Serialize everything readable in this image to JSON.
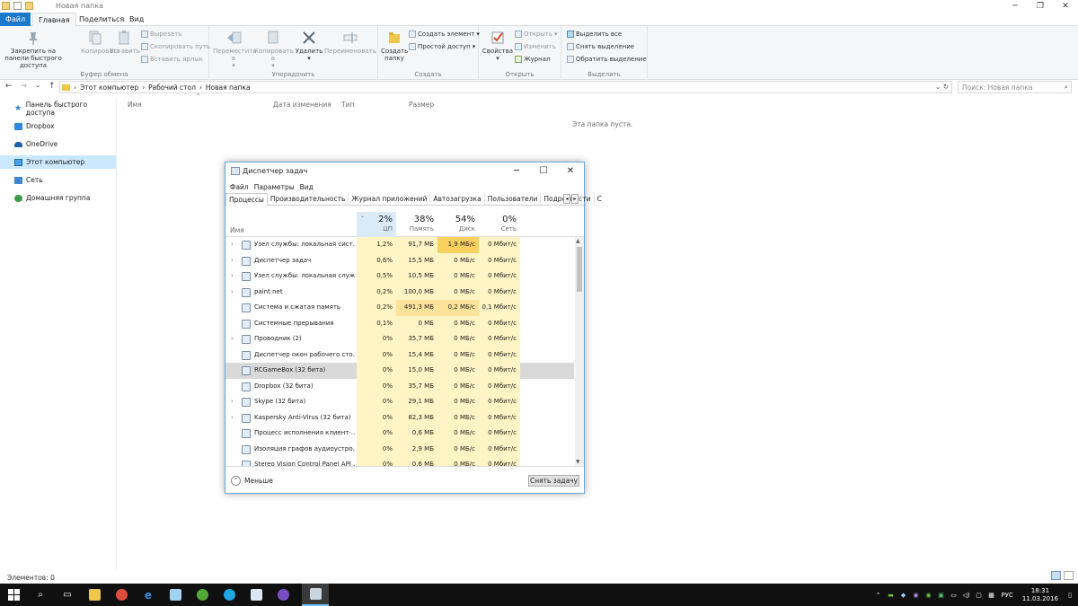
{
  "explorer": {
    "window_title": "Новая папка",
    "tabs": {
      "file": "Файл",
      "home": "Главная",
      "share": "Поделиться",
      "view": "Вид"
    },
    "ribbon": {
      "clipboard": {
        "label": "Буфер обмена",
        "pin": "Закрепить на панели быстрого доступа",
        "copy": "Копировать",
        "paste": "Вставить",
        "cut": "Вырезать",
        "copy_path": "Скопировать путь",
        "paste_shortcut": "Вставить ярлык"
      },
      "organize": {
        "label": "Упорядочить",
        "move_to": "Переместить в",
        "copy_to": "Копировать в",
        "delete": "Удалить",
        "rename": "Переименовать"
      },
      "create": {
        "label": "Создать",
        "new_folder": "Создать папку",
        "new_item": "Создать элемент",
        "easy_access": "Простой доступ"
      },
      "open": {
        "label": "Открыть",
        "properties": "Свойства",
        "open": "Открыть",
        "edit": "Изменить",
        "history": "Журнал"
      },
      "select": {
        "label": "Выделить",
        "select_all": "Выделить все",
        "select_none": "Снять выделение",
        "invert": "Обратить выделение"
      }
    },
    "address": {
      "path": [
        "Этот компьютер",
        "Рабочий стол",
        "Новая папка"
      ],
      "search_placeholder": "Поиск: Новая папка"
    },
    "nav_pane": {
      "items": [
        {
          "label": "Панель быстрого доступа",
          "icon": "star-icon"
        },
        {
          "label": "Dropbox",
          "icon": "dropbox-icon"
        },
        {
          "label": "OneDrive",
          "icon": "cloud-icon"
        },
        {
          "label": "Этот компьютер",
          "icon": "computer-icon"
        },
        {
          "label": "Сеть",
          "icon": "network-icon"
        },
        {
          "label": "Домашняя группа",
          "icon": "homegroup-icon"
        }
      ]
    },
    "columns": {
      "name": "Имя",
      "date": "Дата изменения",
      "type": "Тип",
      "size": "Размер"
    },
    "empty_message": "Эта папка пуста.",
    "status": "Элементов: 0"
  },
  "task_manager": {
    "title": "Диспетчер задач",
    "menu": [
      "Файл",
      "Параметры",
      "Вид"
    ],
    "tabs": [
      "Процессы",
      "Производительность",
      "Журнал приложений",
      "Автозагрузка",
      "Пользователи",
      "Подробности",
      "С"
    ],
    "header": {
      "name": "Имя",
      "cpu": {
        "pct": "2%",
        "label": "ЦП"
      },
      "mem": {
        "pct": "38%",
        "label": "Память"
      },
      "disk": {
        "pct": "54%",
        "label": "Диск"
      },
      "net": {
        "pct": "0%",
        "label": "Сеть"
      }
    },
    "rows": [
      {
        "name": "Узел службы: локальная сист...",
        "cpu": "1,2%",
        "mem": "91,7 МБ",
        "disk": "1,9 МБ/с",
        "net": "0 Мбит/с",
        "expand": "›"
      },
      {
        "name": "Диспетчер задач",
        "cpu": "0,6%",
        "mem": "15,5 МБ",
        "disk": "0 МБ/с",
        "net": "0 Мбит/с",
        "expand": "›"
      },
      {
        "name": "Узел службы: локальная служ...",
        "cpu": "0,5%",
        "mem": "10,5 МБ",
        "disk": "0 МБ/с",
        "net": "0 Мбит/с",
        "expand": "›"
      },
      {
        "name": "paint.net",
        "cpu": "0,2%",
        "mem": "100,0 МБ",
        "disk": "0 МБ/с",
        "net": "0 Мбит/с",
        "expand": "›"
      },
      {
        "name": "Система и сжатая память",
        "cpu": "0,2%",
        "mem": "491,3 МБ",
        "disk": "0,2 МБ/с",
        "net": "0,1 Мбит/с",
        "expand": ""
      },
      {
        "name": "Системные прерывания",
        "cpu": "0,1%",
        "mem": "0 МБ",
        "disk": "0 МБ/с",
        "net": "0 Мбит/с",
        "expand": ""
      },
      {
        "name": "Проводник (2)",
        "cpu": "0%",
        "mem": "35,7 МБ",
        "disk": "0 МБ/с",
        "net": "0 Мбит/с",
        "expand": "›"
      },
      {
        "name": "Диспетчер окон рабочего сто...",
        "cpu": "0%",
        "mem": "15,4 МБ",
        "disk": "0 МБ/с",
        "net": "0 Мбит/с",
        "expand": ""
      },
      {
        "name": "RCGameBox (32 бита)",
        "cpu": "0%",
        "mem": "15,0 МБ",
        "disk": "0 МБ/с",
        "net": "0 Мбит/с",
        "expand": ""
      },
      {
        "name": "Dropbox (32 бита)",
        "cpu": "0%",
        "mem": "35,7 МБ",
        "disk": "0 МБ/с",
        "net": "0 Мбит/с",
        "expand": ""
      },
      {
        "name": "Skype (32 бита)",
        "cpu": "0%",
        "mem": "29,1 МБ",
        "disk": "0 МБ/с",
        "net": "0 Мбит/с",
        "expand": "›"
      },
      {
        "name": "Kaspersky Anti-Virus (32 бита)",
        "cpu": "0%",
        "mem": "82,3 МБ",
        "disk": "0 МБ/с",
        "net": "0 Мбит/с",
        "expand": "›"
      },
      {
        "name": "Процесс исполнения клиент-...",
        "cpu": "0%",
        "mem": "0,6 МБ",
        "disk": "0 МБ/с",
        "net": "0 Мбит/с",
        "expand": ""
      },
      {
        "name": "Изоляция графов аудиоустро...",
        "cpu": "0%",
        "mem": "2,9 МБ",
        "disk": "0 МБ/с",
        "net": "0 Мбит/с",
        "expand": ""
      },
      {
        "name": "Stereo Vision Control Panel API ...",
        "cpu": "0%",
        "mem": "0,6 МБ",
        "disk": "0 МБ/с",
        "net": "0 Мбит/с",
        "expand": ""
      }
    ],
    "footer": {
      "less": "Меньше",
      "end_task": "Снять задачу"
    }
  },
  "taskbar": {
    "tray_lang": "РУС",
    "time": "18:31",
    "date": "11.03.2016"
  }
}
